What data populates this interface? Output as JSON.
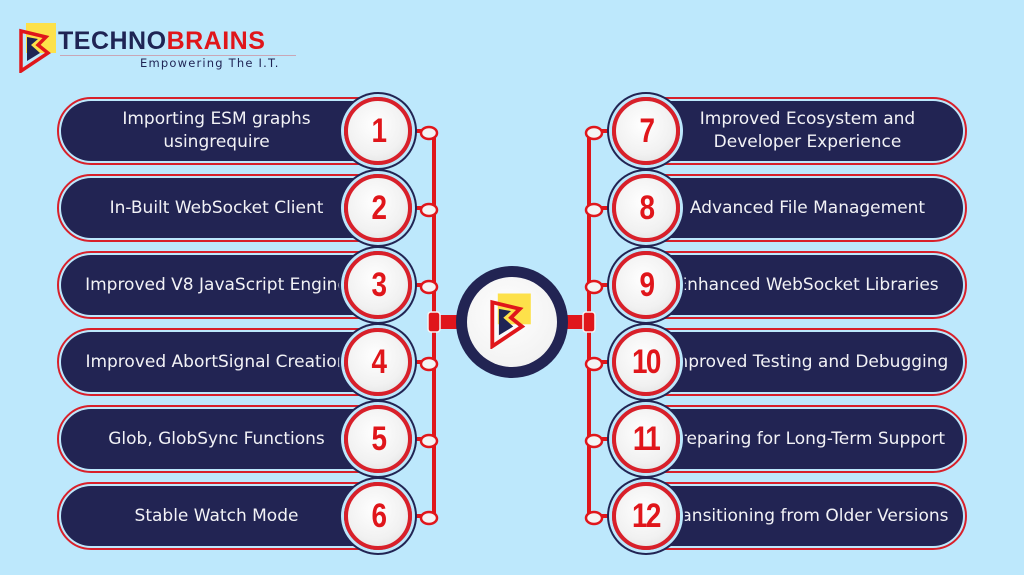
{
  "brand": {
    "name_part1": "TECHNO",
    "name_part2": "BRAINS",
    "tagline": "Empowering The I.T.",
    "logo_icon": "technobrains-logo-mark"
  },
  "colors": {
    "background": "#bde8fc",
    "navy": "#222453",
    "red": "#e0161b",
    "yellow": "#fde14a"
  },
  "hub": {
    "icon": "technobrains-logo-mark"
  },
  "left_items": [
    {
      "number": "1",
      "label": "Importing ESM graphs usingrequire"
    },
    {
      "number": "2",
      "label": "In-Built WebSocket Client"
    },
    {
      "number": "3",
      "label": "Improved V8 JavaScript Engine"
    },
    {
      "number": "4",
      "label": "Improved AbortSignal Creation"
    },
    {
      "number": "5",
      "label": "Glob, GlobSync Functions"
    },
    {
      "number": "6",
      "label": "Stable Watch Mode"
    }
  ],
  "right_items": [
    {
      "number": "7",
      "label": "Improved Ecosystem and Developer Experience"
    },
    {
      "number": "8",
      "label": "Advanced File Management"
    },
    {
      "number": "9",
      "label": "Enhanced WebSocket Libraries"
    },
    {
      "number": "10",
      "label": "Improved Testing and Debugging"
    },
    {
      "number": "11",
      "label": "Preparing for Long-Term Support"
    },
    {
      "number": "12",
      "label": "Transitioning from Older Versions"
    }
  ]
}
